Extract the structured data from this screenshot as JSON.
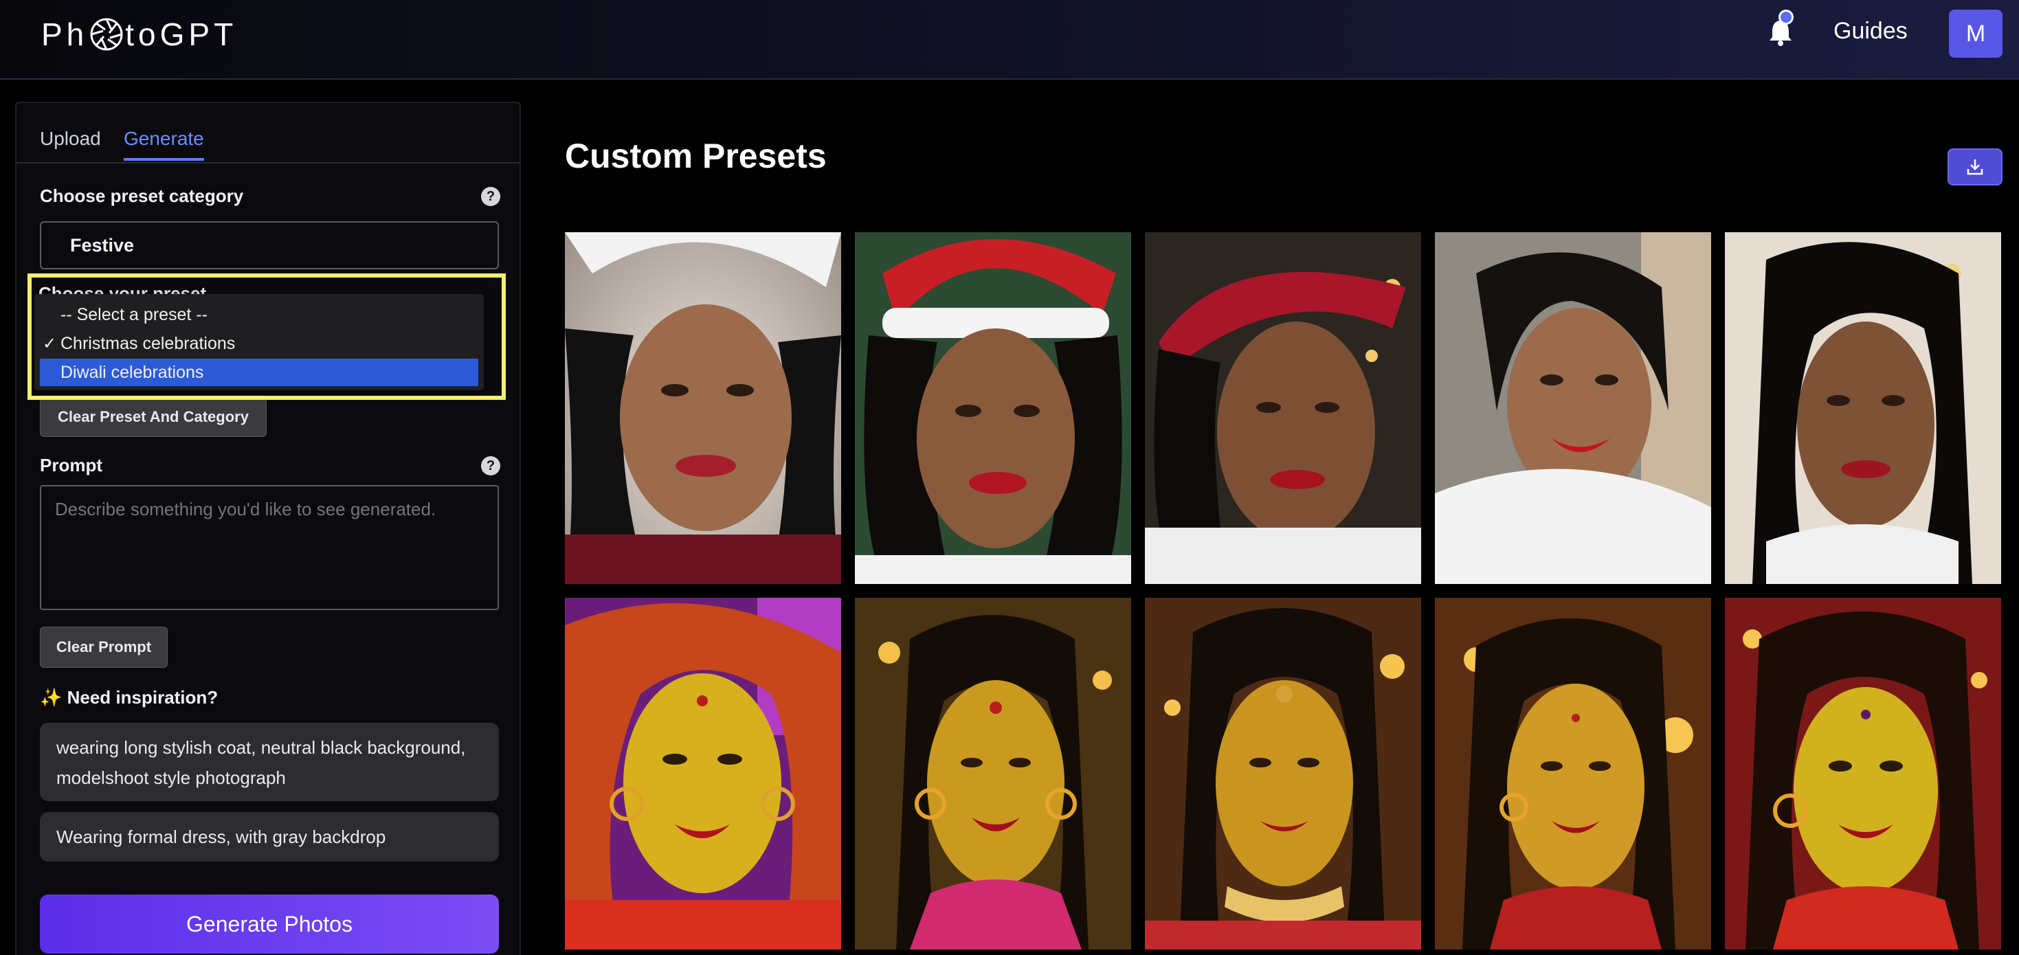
{
  "header": {
    "logo_text_left": "Ph",
    "logo_text_right": "toGPT",
    "guides_label": "Guides",
    "avatar_initial": "M",
    "icons": [
      "aperture-icon",
      "bell-icon",
      "notification-dot"
    ]
  },
  "sidebar": {
    "tabs": [
      {
        "label": "Upload",
        "active": false
      },
      {
        "label": "Generate",
        "active": true
      }
    ],
    "category_label": "Choose preset category",
    "category_value": "Festive",
    "preset_label": "Choose your preset",
    "preset_options": [
      {
        "label": "-- Select a preset --",
        "checked": false,
        "highlighted": false
      },
      {
        "label": "Christmas celebrations",
        "checked": true,
        "highlighted": false
      },
      {
        "label": "Diwali celebrations",
        "checked": false,
        "highlighted": true
      }
    ],
    "clear_preset_label": "Clear Preset And Category",
    "prompt_label": "Prompt",
    "prompt_placeholder": "Describe something you'd like to see generated.",
    "prompt_value": "",
    "clear_prompt_label": "Clear Prompt",
    "inspiration_label": "✨ Need inspiration?",
    "inspirations": [
      "wearing long stylish coat, neutral black background, modelshoot style photograph",
      "Wearing formal dress, with gray backdrop"
    ],
    "generate_label": "Generate Photos",
    "help_symbol": "?"
  },
  "main": {
    "title": "Custom Presets",
    "download_icon": "download-icon",
    "rows": [
      {
        "theme": "christmas",
        "count": 5
      },
      {
        "theme": "diwali",
        "count": 5
      }
    ]
  },
  "colors": {
    "accent": "#5b7cff",
    "button_purple": "#5a2ee8",
    "highlight": "#f6f06a",
    "selected_option": "#2b5bd7"
  }
}
